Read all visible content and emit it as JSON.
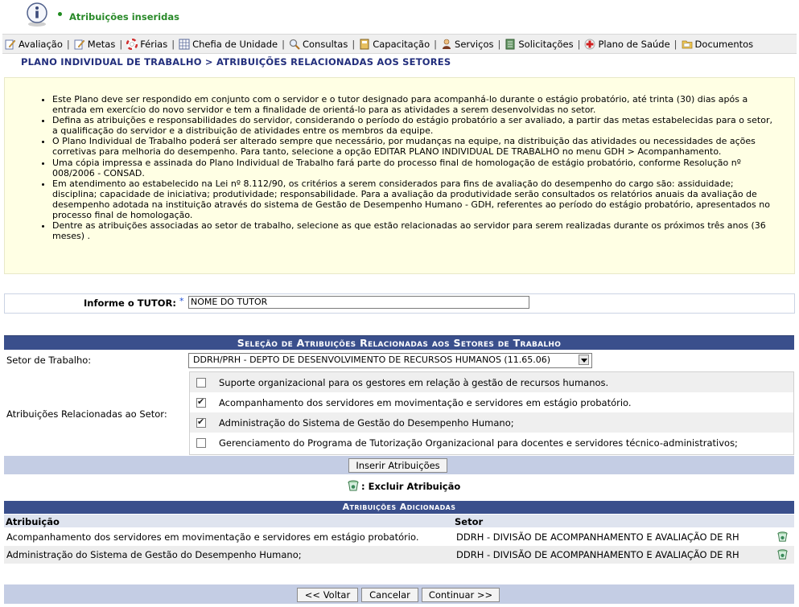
{
  "message": {
    "text": "Atribuições inseridas"
  },
  "menu": {
    "items": [
      {
        "label": "Avaliação",
        "icon": "pencil-paper-icon"
      },
      {
        "label": "Metas",
        "icon": "pencil-paper-icon"
      },
      {
        "label": "Férias",
        "icon": "lifebuoy-icon"
      },
      {
        "label": "Chefia de Unidade",
        "icon": "grid-icon"
      },
      {
        "label": "Consultas",
        "icon": "magnifier-icon"
      },
      {
        "label": "Capacitação",
        "icon": "book-icon"
      },
      {
        "label": "Serviços",
        "icon": "person-icon"
      },
      {
        "label": "Solicitações",
        "icon": "notebook-icon"
      },
      {
        "label": "Plano de Saúde",
        "icon": "health-cross-icon"
      },
      {
        "label": "Documentos",
        "icon": "folder-icon"
      }
    ]
  },
  "page": {
    "title": "PLANO INDIVIDUAL DE TRABALHO > ATRIBUIÇÕES RELACIONADAS AOS SETORES"
  },
  "notice": {
    "items": [
      "Este Plano deve ser respondido em conjunto com o servidor e o tutor designado para acompanhá-lo durante o estágio probatório, até trinta (30) dias após a entrada em exercício do novo servidor e tem a finalidade de orientá-lo para as atividades a serem desenvolvidas no setor.",
      "Defina as atribuições e responsabilidades do servidor, considerando o período do estágio probatório a ser avaliado, a partir das metas estabelecidas para o setor, a qualificação do servidor e a distribuição de atividades entre os membros da equipe.",
      "O Plano Individual de Trabalho poderá ser alterado sempre que necessário, por mudanças na equipe, na distribuição das atividades ou necessidades de ações corretivas para melhoria do desempenho. Para tanto, selecione a opção EDITAR PLANO INDIVIDUAL DE TRABALHO no menu GDH > Acompanhamento.",
      "Uma cópia impressa e assinada do Plano Individual de Trabalho fará parte do processo final de homologação de estágio probatório, conforme Resolução nº 008/2006 - CONSAD.",
      "Em atendimento ao estabelecido na Lei nº 8.112/90, os critérios a serem considerados para fins de avaliação do desempenho do cargo são: assiduidade; disciplina; capacidade de iniciativa; produtividade; responsabilidade. Para a avaliação da produtividade serão consultados os relatórios anuais da avaliação de desempenho adotada na instituição através do sistema de Gestão de Desempenho Humano - GDH, referentes ao período do estágio probatório, apresentados no processo final de homologação.",
      "Dentre as atribuições associadas ao setor de trabalho, selecione as que estão relacionadas ao servidor para serem realizadas durante os próximos três anos (36 meses) ."
    ]
  },
  "tutor": {
    "label": "Informe o TUTOR:",
    "required_mark": "*",
    "value": "NOME DO TUTOR"
  },
  "selection": {
    "header": "Seleção de Atribuições Relacionadas aos Setores de Trabalho",
    "setor_label": "Setor de Trabalho:",
    "setor_value": "DDRH/PRH - DEPTO DE DESENVOLVIMENTO DE RECURSOS HUMANOS (11.65.06)",
    "attr_label": "Atribuições Relacionadas ao Setor:",
    "options": [
      {
        "text": "Suporte organizacional para os gestores em relação à gestão de recursos humanos.",
        "checked": false
      },
      {
        "text": "Acompanhamento dos servidores em movimentação e servidores em estágio probatório.",
        "checked": true
      },
      {
        "text": "Administração do Sistema de Gestão do Desempenho Humano;",
        "checked": true
      },
      {
        "text": "Gerenciamento do Programa de Tutorização Organizacional para docentes e servidores técnico-administrativos;",
        "checked": false
      }
    ],
    "insert_button": "Inserir Atribuições"
  },
  "legend": {
    "delete_label": ": Excluir Atribuição"
  },
  "added": {
    "header": "Atribuições Adicionadas",
    "col_atribuicao": "Atribuição",
    "col_setor": "Setor",
    "rows": [
      {
        "atribuicao": "Acompanhamento dos servidores em movimentação e servidores em estágio probatório.",
        "setor": "DDRH - DIVISÃO DE ACOMPANHAMENTO E AVALIAÇÃO DE RH"
      },
      {
        "atribuicao": "Administração do Sistema de Gestão do Desempenho Humano;",
        "setor": "DDRH - DIVISÃO DE ACOMPANHAMENTO E AVALIAÇÃO DE RH"
      }
    ]
  },
  "footer": {
    "back": "<< Voltar",
    "cancel": "Cancelar",
    "continue": "Continuar >>"
  }
}
